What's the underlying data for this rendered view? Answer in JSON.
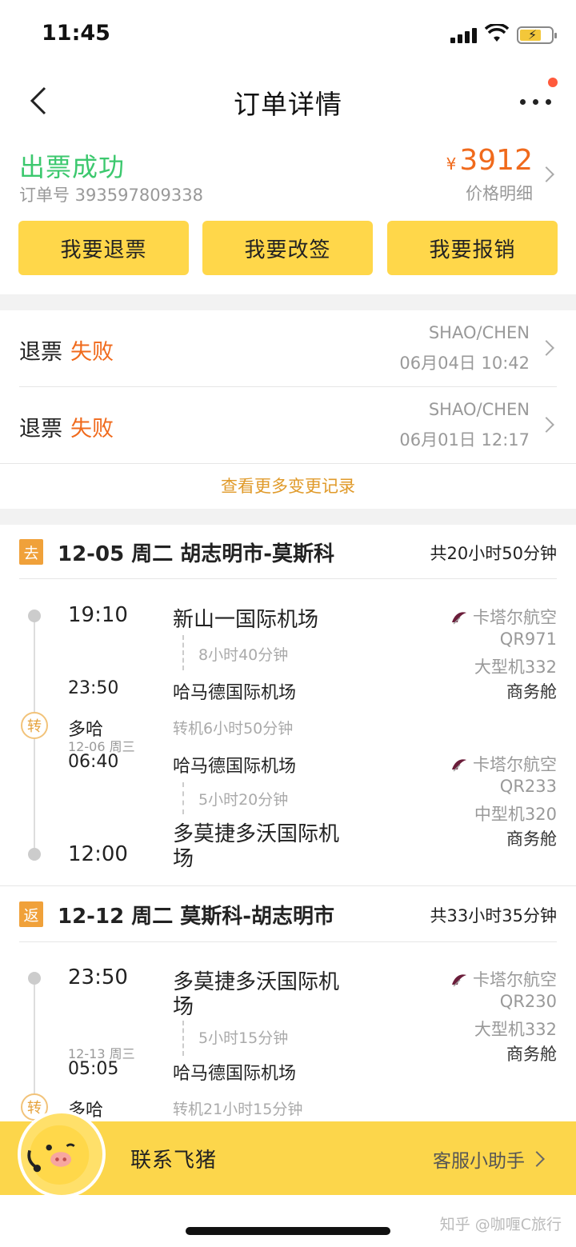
{
  "statusbar": {
    "time": "11:45"
  },
  "nav": {
    "title": "订单详情"
  },
  "order": {
    "status": "出票成功",
    "order_no": "订单号 393597809338",
    "currency": "¥",
    "price": "3912",
    "price_detail": "价格明细"
  },
  "actions": {
    "refund": "我要退票",
    "change": "我要改签",
    "reimburse": "我要报销"
  },
  "records": [
    {
      "label": "退票",
      "result": "失败",
      "name": "SHAO/CHEN",
      "date": "06月04日 10:42"
    },
    {
      "label": "退票",
      "result": "失败",
      "name": "SHAO/CHEN",
      "date": "06月01日 12:17"
    }
  ],
  "more_records": "查看更多变更记录",
  "outbound": {
    "tag": "去",
    "title": "12-05 周二 胡志明市-莫斯科",
    "total": "共20小时50分钟",
    "transfer_tag": "转",
    "leg1": {
      "dep_time": "19:10",
      "dep_airport": "新山一国际机场",
      "duration": "8小时40分钟",
      "arr_time": "23:50",
      "arr_airport": "哈马德国际机场",
      "airline": "卡塔尔航空",
      "flight": "QR971",
      "aircraft": "大型机332",
      "cabin": "商务舱"
    },
    "transfer": {
      "city": "多哈",
      "wait": "转机6小时50分钟",
      "date": "12-06 周三"
    },
    "leg2": {
      "dep_time": "06:40",
      "dep_airport": "哈马德国际机场",
      "duration": "5小时20分钟",
      "arr_time": "12:00",
      "arr_airport_1": "多莫捷多沃国际机",
      "arr_airport_2": "场",
      "airline": "卡塔尔航空",
      "flight": "QR233",
      "aircraft": "中型机320",
      "cabin": "商务舱"
    }
  },
  "return": {
    "tag": "返",
    "title": "12-12 周二 莫斯科-胡志明市",
    "total": "共33小时35分钟",
    "transfer_tag": "转",
    "leg1": {
      "dep_time": "23:50",
      "dep_airport_1": "多莫捷多沃国际机",
      "dep_airport_2": "场",
      "duration": "5小时15分钟",
      "arr_date": "12-13 周三",
      "arr_time": "05:05",
      "arr_airport": "哈马德国际机场",
      "airline": "卡塔尔航空",
      "flight": "QR230",
      "aircraft": "大型机332",
      "cabin": "商务舱"
    },
    "transfer": {
      "city": "多哈",
      "wait": "转机21小时15分钟"
    }
  },
  "footer": {
    "contact": "联系飞猪",
    "assistant": "客服小助手"
  },
  "watermark": "知乎 @咖喱C旅行",
  "colors": {
    "accent": "#ffd74a",
    "success": "#3cc86e",
    "price": "#f06a1c",
    "link": "#e09a2a"
  }
}
